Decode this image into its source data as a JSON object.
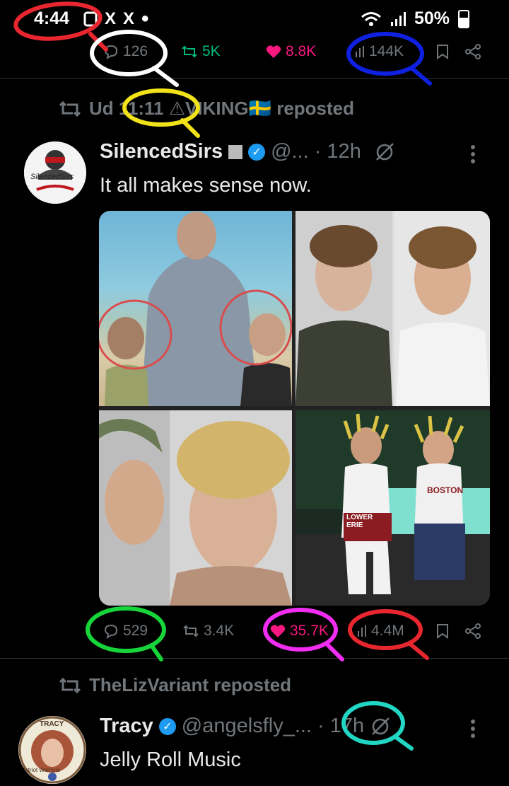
{
  "status_bar": {
    "time": "4:44",
    "notif_icons": [
      "X",
      "X"
    ],
    "battery": "50%"
  },
  "prev_tweet_actions": {
    "replies": "126",
    "reposts": "5K",
    "likes": "8.8K",
    "views": "144K"
  },
  "tweet1": {
    "reposted_by": "Ud 11:11 ⚠VIKING🇸🇪 reposted",
    "display_name": "SilencedSirs",
    "handle": "@...",
    "time": "· 12h",
    "text": "It all makes sense now.",
    "avatar_text": "SilencedSirs",
    "actions": {
      "replies": "529",
      "reposts": "3.4K",
      "likes": "35.7K",
      "views": "4.4M"
    },
    "media_tiles": [
      {
        "name": "beach-photo"
      },
      {
        "name": "mugshot-pair-top"
      },
      {
        "name": "mugshot-pair-bottom"
      },
      {
        "name": "poolside-photo"
      }
    ],
    "jersey_text": "BOSTON",
    "shorts_text": "LOWER ERIE"
  },
  "tweet2": {
    "reposted_by": "TheLizVariant reposted",
    "display_name": "Tracy",
    "handle": "@angelsfly_...",
    "time": "· 17h",
    "text": "Jelly Roll Music",
    "avatar_text": "TRACY",
    "avatar_side_text": "Patriot Warriors"
  },
  "colors": {
    "annot_red": "#e8262f",
    "annot_white": "#ffffff",
    "annot_blue": "#1020e0",
    "annot_yellow": "#f1e21a",
    "annot_green": "#17d43a",
    "annot_magenta": "#f02df0",
    "annot_cyan": "#22d6c4"
  }
}
